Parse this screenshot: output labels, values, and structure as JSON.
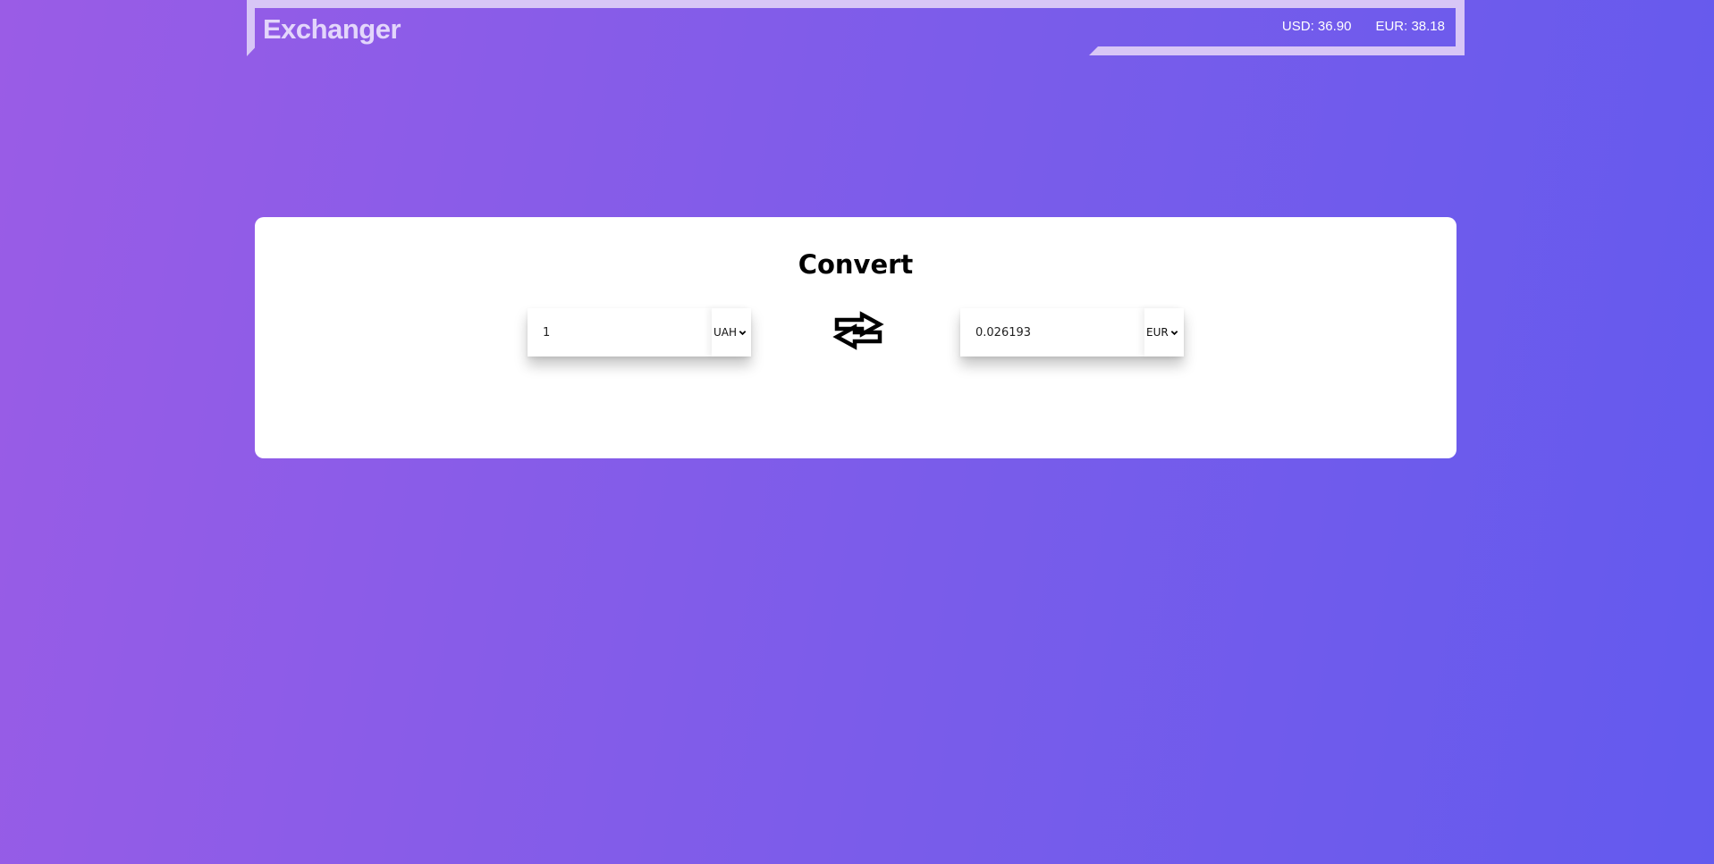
{
  "header": {
    "brand": "Exchanger",
    "rates": [
      {
        "label": "USD: 36.90"
      },
      {
        "label": "EUR: 38.18"
      }
    ]
  },
  "converter": {
    "title": "Convert",
    "from": {
      "amount": "1",
      "currency": "UAH"
    },
    "to": {
      "amount": "0.026193",
      "currency": "EUR"
    },
    "swap_icon": "swap-arrows-icon"
  },
  "colors": {
    "gradient_start": "#9a5ce6",
    "gradient_end": "#635aee",
    "header_frame": "#d8c6f6",
    "brand_text": "#e3d6fb"
  }
}
